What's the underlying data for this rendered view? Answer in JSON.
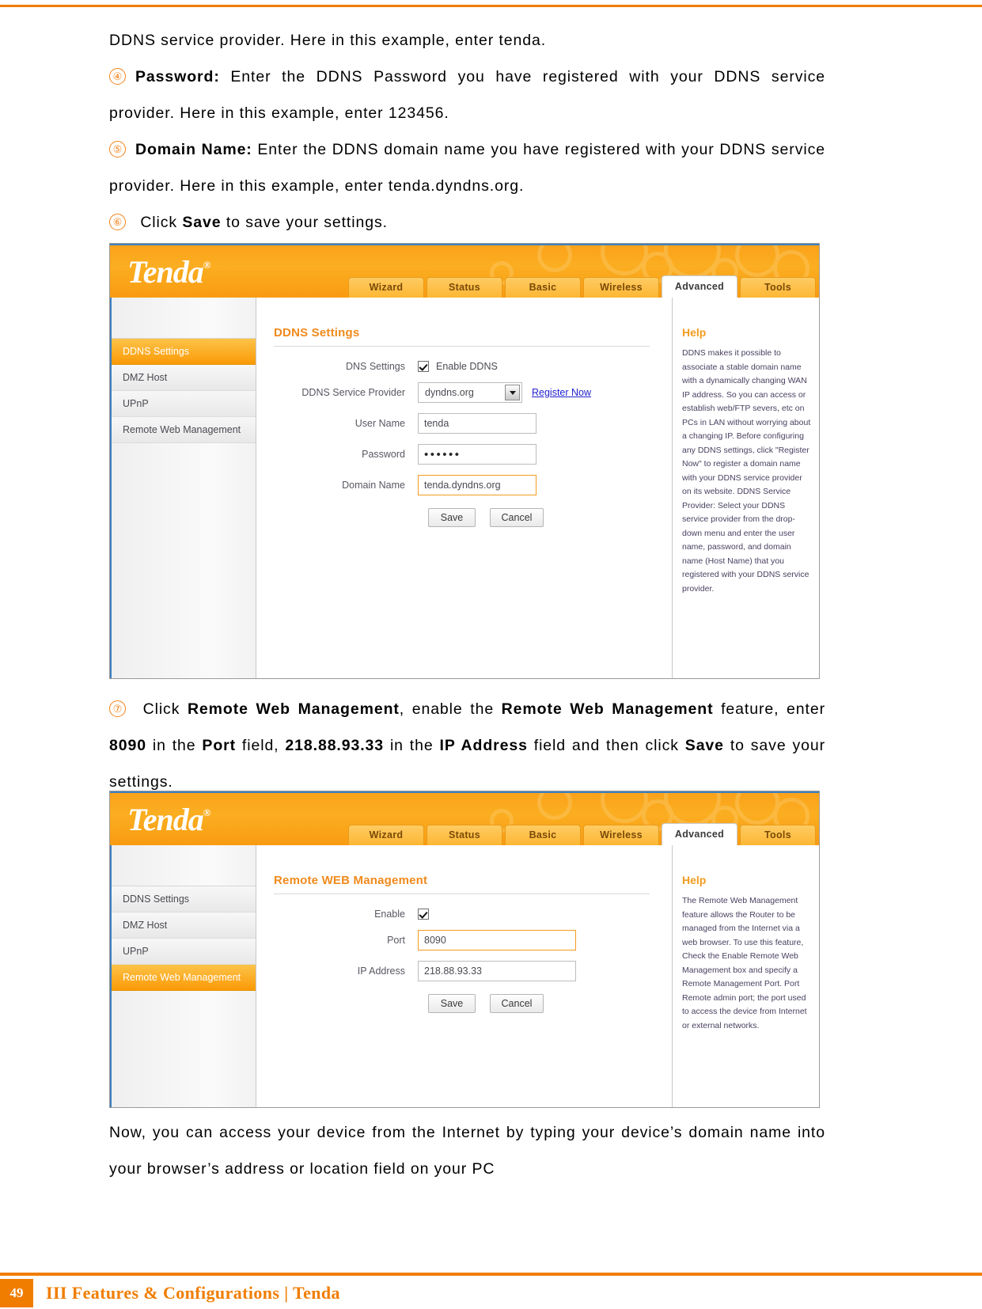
{
  "document": {
    "paragraphs": [
      {
        "id": "p1",
        "text": "DDNS service provider. Here in this example, enter tenda."
      },
      {
        "id": "p2_marker",
        "text": "④"
      },
      {
        "id": "p2_bold",
        "text": "Password:"
      },
      {
        "id": "p2_rest",
        "text": " Enter the DDNS Password you have registered with your DDNS service provider. Here in this example, enter 123456."
      },
      {
        "id": "p3_marker",
        "text": "⑤"
      },
      {
        "id": "p3_bold",
        "text": "Domain Name:"
      },
      {
        "id": "p3_rest",
        "text": " Enter the DDNS domain name you have registered with your DDNS service provider. Here in this example, enter tenda.dyndns.org."
      },
      {
        "id": "p4_marker",
        "text": "⑥"
      },
      {
        "id": "p4_pre",
        "text": " Click "
      },
      {
        "id": "p4_bold",
        "text": "Save"
      },
      {
        "id": "p4_post",
        "text": " to save your settings."
      },
      {
        "id": "p5_marker",
        "text": "⑦"
      },
      {
        "id": "p5_a",
        "text": " Click "
      },
      {
        "id": "p5_b1",
        "text": "Remote Web Management"
      },
      {
        "id": "p5_c",
        "text": ", enable the "
      },
      {
        "id": "p5_b2",
        "text": "Remote Web Management"
      },
      {
        "id": "p5_d",
        "text": " feature, enter "
      },
      {
        "id": "p5_b3",
        "text": "8090"
      },
      {
        "id": "p5_e",
        "text": " in the "
      },
      {
        "id": "p5_b4",
        "text": "Port"
      },
      {
        "id": "p5_f",
        "text": " field, "
      },
      {
        "id": "p5_b5",
        "text": "218.88.93.33"
      },
      {
        "id": "p5_g",
        "text": " in the "
      },
      {
        "id": "p5_b6",
        "text": "IP Address"
      },
      {
        "id": "p5_h",
        "text": " field and then click "
      },
      {
        "id": "p5_b7",
        "text": "Save"
      },
      {
        "id": "p5_i",
        "text": " to save your settings."
      },
      {
        "id": "p6",
        "text": "Now, you can access your device from the Internet by typing your device’s domain name into your browser’s address or location field on your PC"
      }
    ]
  },
  "footer": {
    "page_number": "49",
    "text": "III Features & Configurations | Tenda"
  },
  "screenshot1": {
    "brand": {
      "logo": "Tenda",
      "registered": "®"
    },
    "tabs": [
      {
        "label": "Wizard",
        "active": false
      },
      {
        "label": "Status",
        "active": false
      },
      {
        "label": "Basic",
        "active": false
      },
      {
        "label": "Wireless",
        "active": false
      },
      {
        "label": "Advanced",
        "active": true
      },
      {
        "label": "Tools",
        "active": false
      }
    ],
    "sidebar": [
      {
        "label": "DDNS Settings",
        "active": true
      },
      {
        "label": "DMZ Host",
        "active": false
      },
      {
        "label": "UPnP",
        "active": false
      },
      {
        "label": "Remote Web Management",
        "active": false
      }
    ],
    "form": {
      "title": "DDNS Settings",
      "rows": [
        {
          "label": "DNS Settings",
          "kind": "checkbox",
          "checkbox_label": "Enable DDNS",
          "checked": true
        },
        {
          "label": "DDNS Service Provider",
          "kind": "select",
          "value": "dyndns.org",
          "link": "Register Now"
        },
        {
          "label": "User Name",
          "kind": "text",
          "value": "tenda",
          "highlight": false
        },
        {
          "label": "Password",
          "kind": "password",
          "value": "••••••",
          "highlight": false
        },
        {
          "label": "Domain Name",
          "kind": "text",
          "value": "tenda.dyndns.org",
          "highlight": true
        }
      ],
      "save_label": "Save",
      "cancel_label": "Cancel"
    },
    "help": {
      "title": "Help",
      "body": "DDNS makes it possible to associate a stable domain name with a dynamically changing WAN IP address. So you can access or establish web/FTP severs, etc on PCs in LAN without worrying about a changing IP. Before configuring any DDNS settings, click \"Register Now\" to register a domain name with your DDNS service provider on its website. DDNS Service Provider: Select your DDNS service provider from the drop-down menu and enter the user name, password, and domain name (Host Name) that you registered with your DDNS service provider."
    }
  },
  "screenshot2": {
    "brand": {
      "logo": "Tenda",
      "registered": "®"
    },
    "tabs": [
      {
        "label": "Wizard",
        "active": false
      },
      {
        "label": "Status",
        "active": false
      },
      {
        "label": "Basic",
        "active": false
      },
      {
        "label": "Wireless",
        "active": false
      },
      {
        "label": "Advanced",
        "active": true
      },
      {
        "label": "Tools",
        "active": false
      }
    ],
    "sidebar": [
      {
        "label": "DDNS Settings",
        "active": false
      },
      {
        "label": "DMZ Host",
        "active": false
      },
      {
        "label": "UPnP",
        "active": false
      },
      {
        "label": "Remote Web Management",
        "active": true
      }
    ],
    "form": {
      "title": "Remote WEB Management",
      "rows": [
        {
          "label": "Enable",
          "kind": "checkbox",
          "checkbox_label": "",
          "checked": true
        },
        {
          "label": "Port",
          "kind": "text",
          "value": "8090",
          "highlight": true
        },
        {
          "label": "IP Address",
          "kind": "text",
          "value": "218.88.93.33",
          "highlight": false
        }
      ],
      "save_label": "Save",
      "cancel_label": "Cancel"
    },
    "help": {
      "title": "Help",
      "body": "The Remote Web Management feature allows the Router to be managed from the Internet via a web browser. To use this feature, Check the Enable Remote Web Management box and specify a Remote Management Port. Port Remote admin port; the port used to access the device from Internet or external networks."
    }
  },
  "colors": {
    "brand_orange": "#F07D00",
    "accent_orange": "#F29B1F",
    "link_blue": "#2222cc"
  }
}
